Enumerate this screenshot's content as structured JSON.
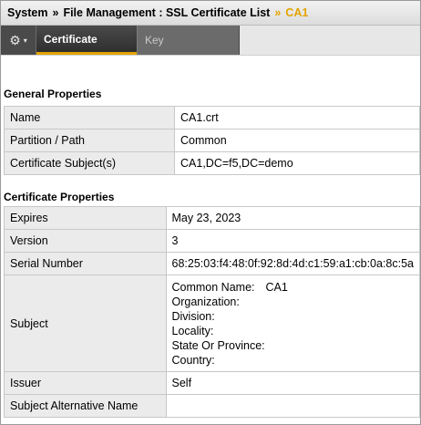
{
  "breadcrumb": {
    "items": [
      "System",
      "File Management : SSL Certificate List",
      "CA1"
    ],
    "separator": "»"
  },
  "tabs": {
    "gear_icon": "⚙",
    "caret": "▾",
    "certificate": "Certificate",
    "key": "Key"
  },
  "general": {
    "title": "General Properties",
    "rows": [
      {
        "label": "Name",
        "value": "CA1.crt"
      },
      {
        "label": "Partition / Path",
        "value": "Common"
      },
      {
        "label": "Certificate Subject(s)",
        "value": "CA1,DC=f5,DC=demo"
      }
    ]
  },
  "cert": {
    "title": "Certificate Properties",
    "rows": [
      {
        "label": "Expires",
        "value": "May 23, 2023"
      },
      {
        "label": "Version",
        "value": "3"
      },
      {
        "label": "Serial Number",
        "value": "68:25:03:f4:48:0f:92:8d:4d:c1:59:a1:cb:0a:8c:5a"
      }
    ],
    "subject": {
      "label": "Subject",
      "common_name_label": "Common Name:",
      "common_name_value": "CA1",
      "organization": "Organization:",
      "division": "Division:",
      "locality": "Locality:",
      "state": "State Or Province:",
      "country": "Country:"
    },
    "issuer": {
      "label": "Issuer",
      "value": "Self"
    },
    "san": {
      "label": "Subject Alternative Name",
      "value": ""
    }
  },
  "colors": {
    "accent": "#e3a400",
    "tab_dark": "#4a4a4a"
  }
}
